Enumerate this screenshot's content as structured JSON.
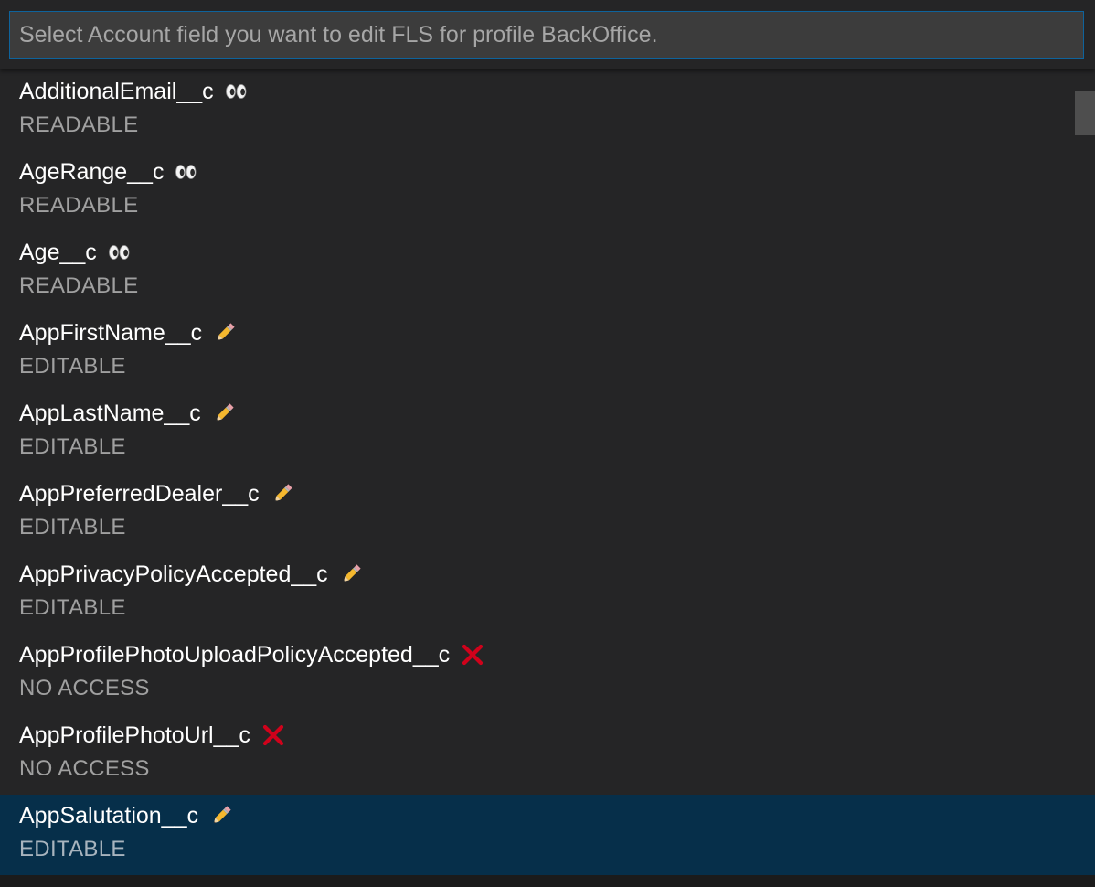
{
  "quick_pick": {
    "placeholder": "Select Account field you want to edit FLS for profile BackOffice.",
    "value": ""
  },
  "items": [
    {
      "label": "AdditionalEmail__c",
      "icon": "eyes-icon",
      "description": "READABLE",
      "selected": false
    },
    {
      "label": "AgeRange__c",
      "icon": "eyes-icon",
      "description": "READABLE",
      "selected": false
    },
    {
      "label": "Age__c",
      "icon": "eyes-icon",
      "description": "READABLE",
      "selected": false
    },
    {
      "label": "AppFirstName__c",
      "icon": "pencil-icon",
      "description": "EDITABLE",
      "selected": false
    },
    {
      "label": "AppLastName__c",
      "icon": "pencil-icon",
      "description": "EDITABLE",
      "selected": false
    },
    {
      "label": "AppPreferredDealer__c",
      "icon": "pencil-icon",
      "description": "EDITABLE",
      "selected": false
    },
    {
      "label": "AppPrivacyPolicyAccepted__c",
      "icon": "pencil-icon",
      "description": "EDITABLE",
      "selected": false
    },
    {
      "label": "AppProfilePhotoUploadPolicyAccepted__c",
      "icon": "cross-mark-icon",
      "description": "NO ACCESS",
      "selected": false
    },
    {
      "label": "AppProfilePhotoUrl__c",
      "icon": "cross-mark-icon",
      "description": "NO ACCESS",
      "selected": false
    },
    {
      "label": "AppSalutation__c",
      "icon": "pencil-icon",
      "description": "EDITABLE",
      "selected": true
    }
  ],
  "colors": {
    "background": "#252526",
    "input_background": "#3c3c3c",
    "focus_border": "#0e639c",
    "selection": "#062f4a",
    "label": "#ffffff",
    "description": "#a0a0a0",
    "cross_mark": "#d0021b"
  }
}
